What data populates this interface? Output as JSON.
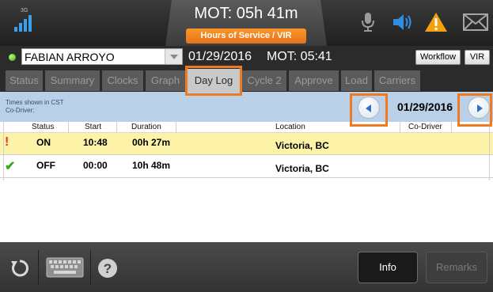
{
  "status_bar": {
    "network_label": "3G",
    "mot_title": "MOT: 05h 41m",
    "hos_tab_label": "Hours of Service / VIR",
    "icons": [
      "signal-icon",
      "mic-icon",
      "speaker-icon",
      "warning-icon",
      "mail-icon"
    ]
  },
  "driver": {
    "name": "FABIAN ARROYO",
    "date": "01/29/2016",
    "mot": "MOT: 05:41",
    "workflow_label": "Workflow",
    "vir_label": "VIR"
  },
  "tabs": [
    {
      "label": "Status",
      "active": false
    },
    {
      "label": "Summary",
      "active": false
    },
    {
      "label": "Clocks",
      "active": false
    },
    {
      "label": "Graph",
      "active": false
    },
    {
      "label": "Day Log",
      "active": true
    },
    {
      "label": "Cycle 2",
      "active": false
    },
    {
      "label": "Approve",
      "active": false
    },
    {
      "label": "Load",
      "active": false
    },
    {
      "label": "Carriers",
      "active": false
    }
  ],
  "log_header": {
    "timezone_note": "Times shown in CST",
    "co_driver_note": "Co-Driver:",
    "date": "01/29/2016"
  },
  "table": {
    "columns": [
      "Status",
      "Start",
      "Duration",
      "Location",
      "Co-Driver"
    ],
    "rows": [
      {
        "flag": "!",
        "flag_color": "#e03a1a",
        "status": "ON",
        "start": "10:48",
        "duration": "00h 27m",
        "location": "Victoria, BC",
        "co_driver": "",
        "highlight": "#fcf3a8"
      },
      {
        "flag": "✔",
        "flag_color": "#38a818",
        "status": "OFF",
        "start": "00:00",
        "duration": "10h 48m",
        "location": "Victoria, BC",
        "co_driver": "",
        "highlight": "#ffffff"
      }
    ]
  },
  "footer": {
    "info_label": "Info",
    "remarks_label": "Remarks",
    "icons": [
      "refresh-icon",
      "keyboard-icon",
      "help-icon"
    ]
  },
  "colors": {
    "accent_orange": "#f07a1f",
    "accent_blue": "#2f6fd0",
    "warning_yellow": "#f5a10f"
  }
}
